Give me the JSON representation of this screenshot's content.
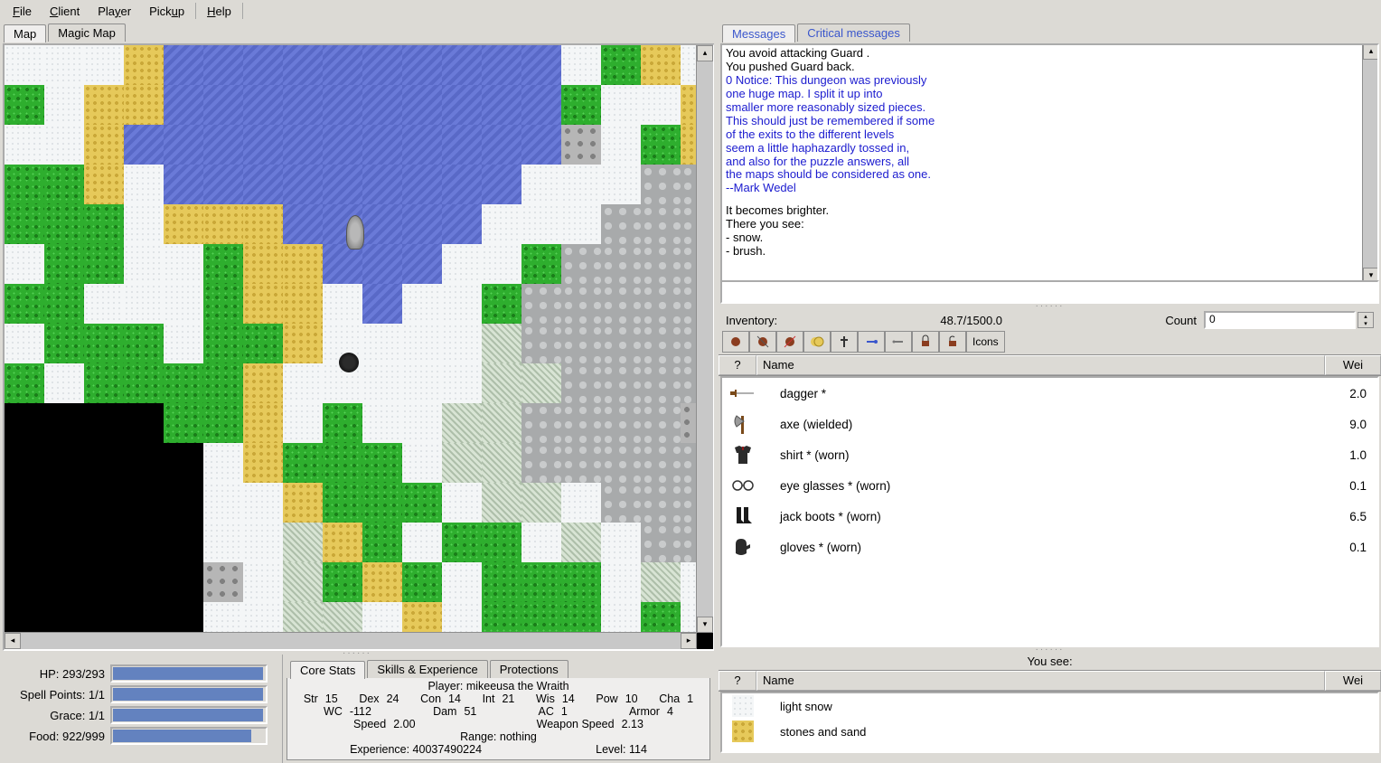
{
  "menu": {
    "file": "File",
    "client": "Client",
    "player": "Player",
    "pickup": "Pickup",
    "help": "Help"
  },
  "map_tabs": {
    "map": "Map",
    "magic": "Magic Map"
  },
  "msg_tabs": {
    "messages": "Messages",
    "critical": "Critical messages"
  },
  "messages": {
    "l1": "You avoid attacking Guard .",
    "l2": "You pushed Guard back.",
    "l3": "0 Notice: This dungeon was previously",
    "l4": "one huge map.  I split it up into",
    "l5": "smaller more reasonably sized pieces.",
    "l6": "This should just be remembered if some",
    "l7": "of the exits to the different levels",
    "l8": "seem a little haphazardly tossed in,",
    "l9": "and also for the puzzle answers, all",
    "l10": "the maps should be considered as one.",
    "l11": "--Mark Wedel",
    "l12": "It becomes brighter.",
    "l13": "There you see:",
    "l14": "- snow.",
    "l15": "- brush."
  },
  "inv": {
    "label": "Inventory:",
    "weight": "48.7/1500.0",
    "count_label": "Count",
    "count_value": "0",
    "icons_tab": "Icons",
    "cols": {
      "q": "?",
      "name": "Name",
      "wei": "Wei"
    },
    "items": [
      {
        "name": "dagger  *",
        "wei": "2.0"
      },
      {
        "name": "axe  (wielded)",
        "wei": "9.0"
      },
      {
        "name": "shirt  * (worn)",
        "wei": "1.0"
      },
      {
        "name": "eye glasses  * (worn)",
        "wei": "0.1"
      },
      {
        "name": "jack boots  * (worn)",
        "wei": "6.5"
      },
      {
        "name": "gloves  * (worn)",
        "wei": "0.1"
      }
    ]
  },
  "floor": {
    "header": "You see:",
    "cols": {
      "q": "?",
      "name": "Name",
      "wei": "Wei"
    },
    "items": [
      {
        "name": "light snow",
        "wei": ""
      },
      {
        "name": "stones and sand",
        "wei": ""
      }
    ]
  },
  "vitals": {
    "hp": {
      "label": "HP: 293/293",
      "pct": 100
    },
    "sp": {
      "label": "Spell Points: 1/1",
      "pct": 100
    },
    "gr": {
      "label": "Grace: 1/1",
      "pct": 100
    },
    "fd": {
      "label": "Food: 922/999",
      "pct": 92
    }
  },
  "stat_tabs": {
    "core": "Core Stats",
    "skills": "Skills & Experience",
    "prot": "Protections"
  },
  "stats": {
    "player": "Player: mikeeusa the Wraith",
    "row1": {
      "str_l": "Str",
      "str": "15",
      "dex_l": "Dex",
      "dex": "24",
      "con_l": "Con",
      "con": "14",
      "int_l": "Int",
      "int": "21",
      "wis_l": "Wis",
      "wis": "14",
      "pow_l": "Pow",
      "pow": "10",
      "cha_l": "Cha",
      "cha": "1"
    },
    "row2": {
      "wc_l": "WC",
      "wc": "-112",
      "dam_l": "Dam",
      "dam": "51",
      "ac_l": "AC",
      "ac": "1",
      "arm_l": "Armor",
      "arm": "4"
    },
    "row3": {
      "spd_l": "Speed",
      "spd": "2.00",
      "ws_l": "Weapon Speed",
      "ws": "2.13"
    },
    "range": "Range: nothing",
    "exp": "Experience: 40037490224",
    "lvl": "Level: 114"
  }
}
